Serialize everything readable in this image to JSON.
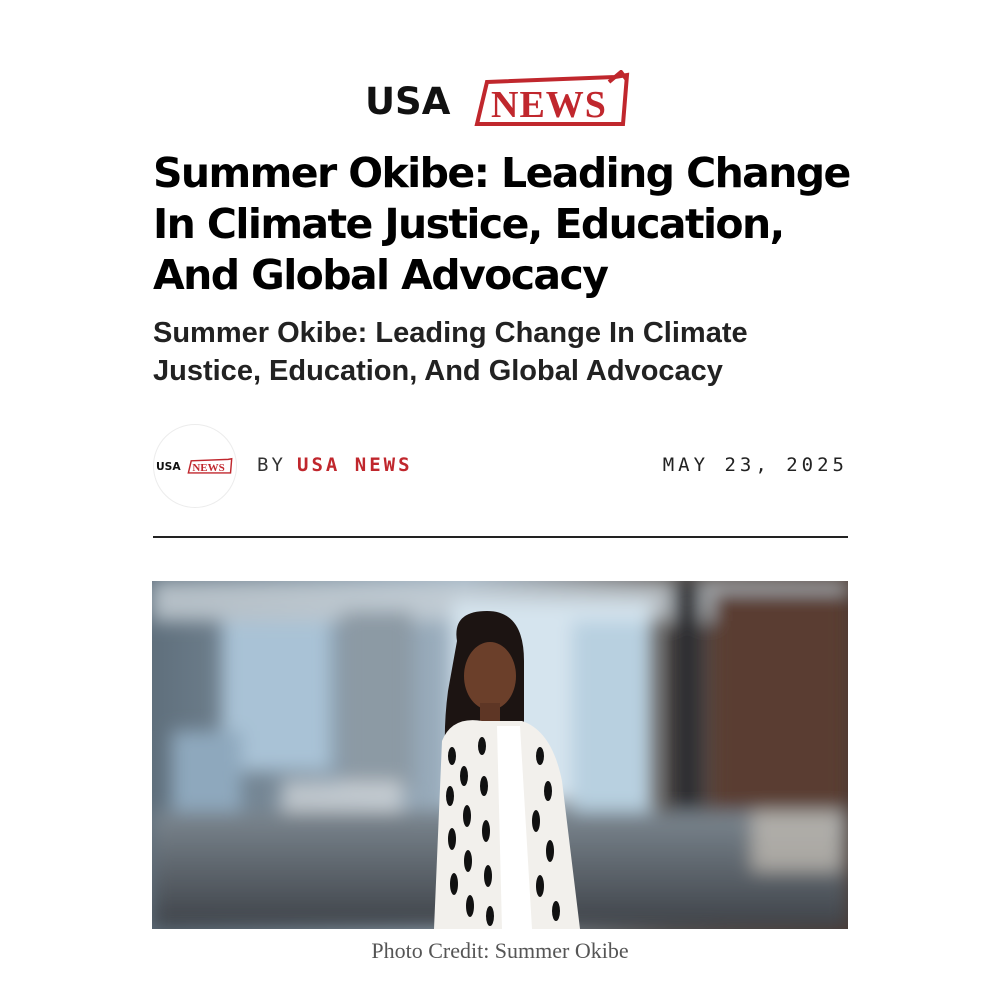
{
  "site": {
    "logo_usa": "USA",
    "logo_news": "NEWS",
    "brand_color": "#c0272d"
  },
  "article": {
    "headline": "Summer Okibe: Leading Change In Climate Justice, Education, And Global Advocacy",
    "subheadline": "Summer Okibe: Leading Change In Climate Justice, Education, And Global Advocacy",
    "by_label": "BY",
    "author": "USA NEWS",
    "date": "MAY 23, 2025"
  },
  "photo": {
    "caption": "Photo Credit: Summer Okibe",
    "alt": "Summer Okibe"
  }
}
